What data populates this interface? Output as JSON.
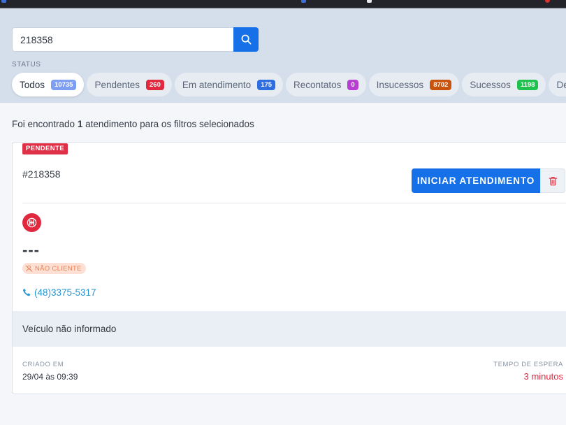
{
  "search": {
    "value": "218358",
    "button_icon": "search-icon"
  },
  "filters": {
    "status_label": "STATUS",
    "tabs": [
      {
        "label": "Todos",
        "count": "10735",
        "badge_color": "#7e9ef4",
        "active": true
      },
      {
        "label": "Pendentes",
        "count": "260",
        "badge_color": "#e0283e",
        "active": false
      },
      {
        "label": "Em atendimento",
        "count": "175",
        "badge_color": "#2f6ee0",
        "active": false
      },
      {
        "label": "Recontatos",
        "count": "0",
        "badge_color": "#b83ed1",
        "active": false
      },
      {
        "label": "Insucessos",
        "count": "8702",
        "badge_color": "#c9530c",
        "active": false
      },
      {
        "label": "Sucessos",
        "count": "1198",
        "badge_color": "#1fc24f",
        "active": false
      },
      {
        "label": "Desca",
        "count": "",
        "badge_color": "",
        "active": false
      }
    ]
  },
  "results": {
    "prefix": "Foi encontrado",
    "count": "1",
    "suffix": "atendimento para os filtros selecionados"
  },
  "card": {
    "status_tag": "PENDENTE",
    "ticket_id": "#218358",
    "start_button": "INICIAR ATENDIMENTO",
    "delete_icon": "trash-icon",
    "logo_icon": "company-logo-icon",
    "client_name": "---",
    "client_badge": "NÃO CLIENTE",
    "client_badge_icon": "user-slash-icon",
    "phone": "(48)3375-5317",
    "phone_icon": "phone-icon",
    "vehicle": "Veículo não informado",
    "created_label": "CRIADO EM",
    "created_value": "29/04 às 09:39",
    "wait_label": "TEMPO DE ESPERA",
    "wait_value": "3 minutos"
  },
  "colors": {
    "primary": "#1670e8",
    "danger": "#e0283e",
    "panel_bg": "#d5dfec"
  }
}
